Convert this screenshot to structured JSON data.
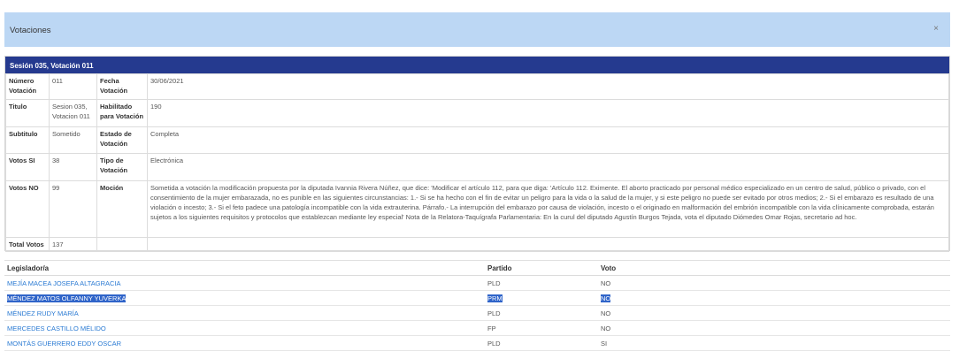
{
  "modal": {
    "title": "Votaciones",
    "close_symbol": "×"
  },
  "session": {
    "header": "Sesión 035, Votación 011",
    "labels": {
      "numero": "Número Votación",
      "fecha": "Fecha Votación",
      "titulo": "Titulo",
      "habilitado": "Habilitado para Votación",
      "subtitulo": "Subtitulo",
      "estado": "Estado de Votación",
      "votos_si": "Votos SI",
      "tipo": "Tipo de Votación",
      "votos_no": "Votos NO",
      "mocion": "Moción",
      "total": "Total Votos"
    },
    "values": {
      "numero": "011",
      "fecha": "30/06/2021",
      "titulo": "Sesion 035, Votacion 011",
      "habilitado": "190",
      "subtitulo": "Sometido",
      "estado": "Completa",
      "votos_si": "38",
      "tipo": "Electrónica",
      "votos_no": "99",
      "mocion": "Sometida a votación la modificación propuesta por la diputada Ivannia Rivera Núñez, que dice: 'Modificar el artículo 112, para que diga: 'Artículo 112. Eximente. El aborto practicado por personal médico especializado en un centro de salud, público o privado, con el consentimiento de la mujer embarazada, no es punible en las siguientes circunstancias: 1.- Si se ha hecho con el fin de evitar un peligro para la vida o la salud de la mujer, y si este peligro no puede ser evitado por otros medios; 2.- Si el embarazo es resultado de una violación o incesto; 3.- Si el feto padece una patología incompatible con la vida extrauterina. Párrafo.- La interrupción del embarazo por causa de violación, incesto o el originado en malformación del embrión incompatible con la vida clínicamente comprobada, estarán sujetos a los siguientes requisitos y protocolos que establezcan mediante ley especial' Nota de la Relatora-Taquígrafa Parlamentaria: En la curul del diputado Agustín Burgos Tejada, vota el diputado Diómedes Omar Rojas, secretario ad hoc.",
      "total": "137"
    }
  },
  "votes": {
    "headers": {
      "legislador": "Legislador/a",
      "partido": "Partido",
      "voto": "Voto"
    },
    "rows": [
      {
        "name": "MEJÍA MACEA JOSEFA ALTAGRACIA",
        "party": "PLD",
        "vote": "NO"
      },
      {
        "name": "MÉNDEZ MATOS OLFANNY YUVERKA",
        "party": "PRM",
        "vote": "NO"
      },
      {
        "name": "MÉNDEZ RUDY MARÍA",
        "party": "PLD",
        "vote": "NO"
      },
      {
        "name": "MERCEDES CASTILLO MÉLIDO",
        "party": "FP",
        "vote": "NO"
      },
      {
        "name": "MONTÁS GUERRERO EDDY OSCAR",
        "party": "PLD",
        "vote": "SI"
      }
    ]
  }
}
